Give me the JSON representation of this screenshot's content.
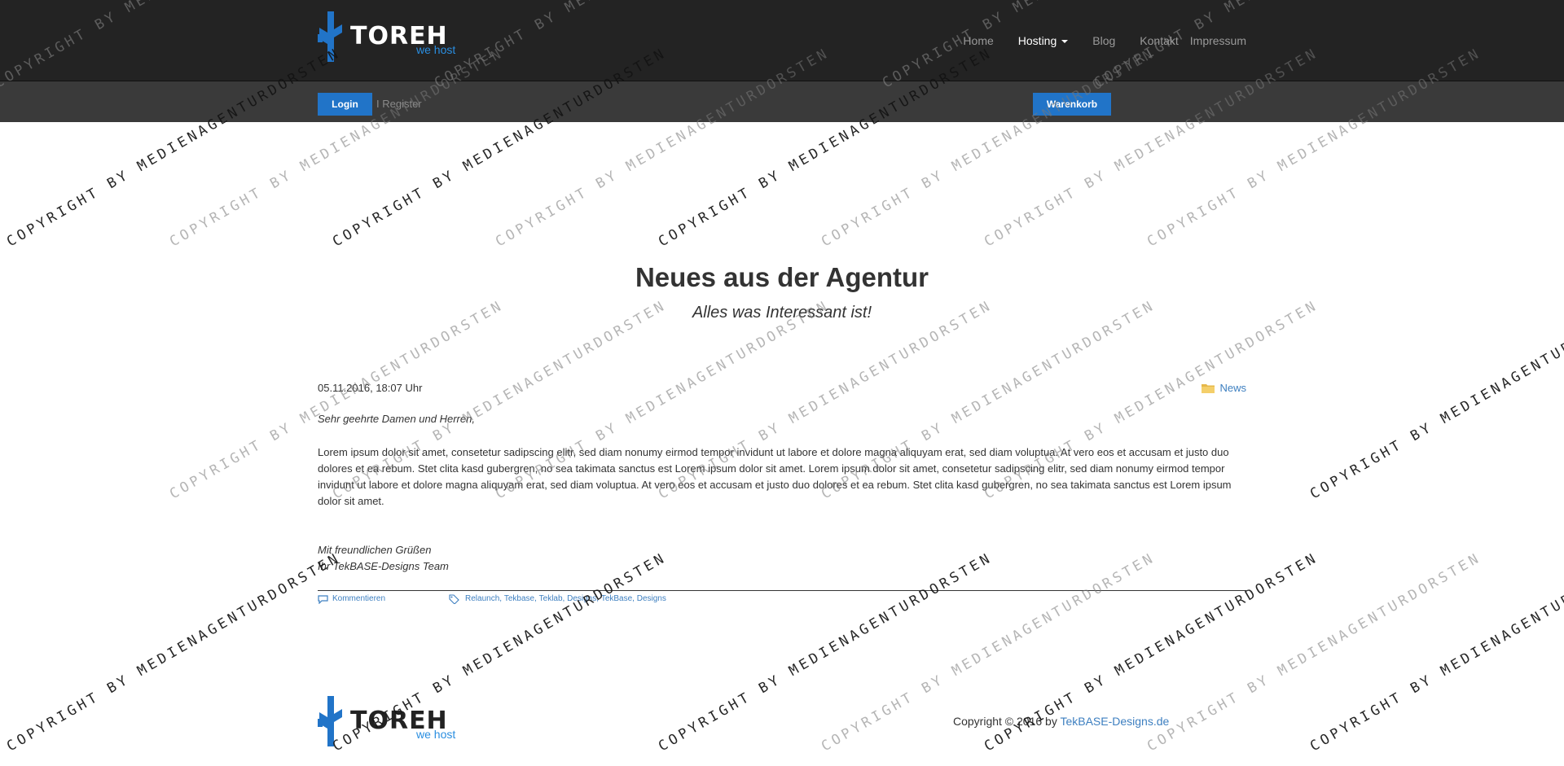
{
  "header": {
    "logo_word": "TOREH",
    "logo_tagline": "we host",
    "nav": [
      {
        "label": "Home",
        "active": false
      },
      {
        "label": "Hosting",
        "active": true,
        "dropdown": true
      },
      {
        "label": "Blog",
        "active": false
      },
      {
        "label": "Kontakt",
        "active": false
      },
      {
        "label": "Impressum",
        "active": false
      }
    ]
  },
  "subbar": {
    "login_label": "Login",
    "register_label": "I Register",
    "cart_label": "Warenkorb"
  },
  "page": {
    "title": "Neues aus der Agentur",
    "subtitle": "Alles was Interessant ist!"
  },
  "post": {
    "date": "05.11.2016, 18:07 Uhr",
    "category": "News",
    "greeting": "Sehr geehrte Damen und Herren,",
    "body": "Lorem ipsum dolor sit amet, consetetur sadipscing elitr, sed diam nonumy eirmod tempor invidunt ut labore et dolore magna aliquyam erat, sed diam voluptua. At vero eos et accusam et justo duo dolores et ea rebum. Stet clita kasd gubergren, no sea takimata sanctus est Lorem ipsum dolor sit amet. Lorem ipsum dolor sit amet, consetetur sadipscing elitr, sed diam nonumy eirmod tempor invidunt ut labore et dolore magna aliquyam erat, sed diam voluptua. At vero eos et accusam et justo duo dolores et ea rebum. Stet clita kasd gubergren, no sea takimata sanctus est Lorem ipsum dolor sit amet.",
    "closing_1": "Mit freundlichen Grüßen",
    "closing_2": "Ihr TekBASE-Designs Team",
    "comments_label": "Kommentieren",
    "tags": [
      "Relaunch",
      "Tekbase",
      "Teklab",
      "Designs",
      "TekBase, Designs"
    ]
  },
  "footer": {
    "copyright_prefix": "Copyright © 2016 by ",
    "copyright_link": "TekBASE-Designs.de"
  },
  "watermark": {
    "text_a": "COPYRIGHT BY MEDIENAGENTURDORSTEN",
    "text_b": "COPYRIGHT BY MEDIENAGENTURDORSTEN"
  },
  "colors": {
    "brand_blue": "#2174c8",
    "link_blue": "#3d7fc0",
    "header_dark": "#232323",
    "subbar_gray": "#3a3a3a"
  }
}
